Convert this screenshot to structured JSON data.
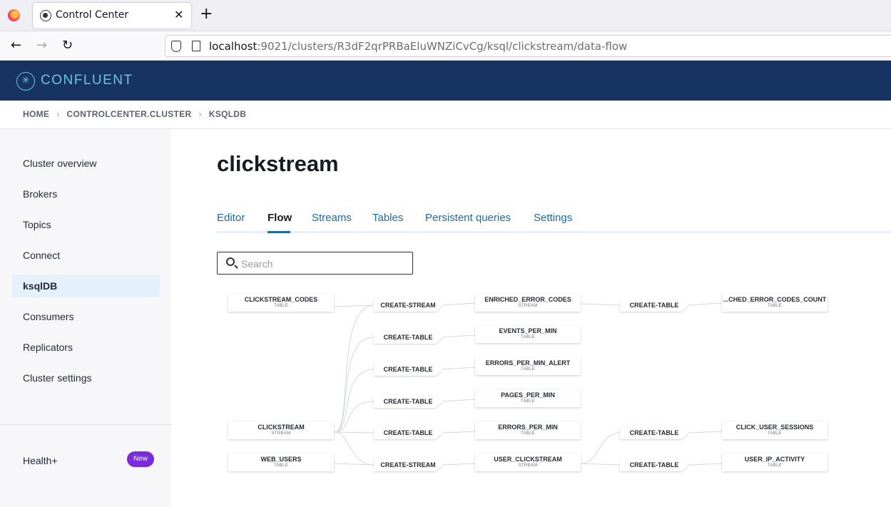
{
  "browser": {
    "tab_title": "Control Center",
    "tab_close": "✕",
    "new_tab": "+",
    "url_host": "localhost",
    "url_rest": ":9021/clusters/R3dF2qrPRBaEluWNZiCvCg/ksql/clickstream/data-flow",
    "back": "←",
    "forward": "→",
    "reload": "↻"
  },
  "header": {
    "brand": "CONFLUENT",
    "brand_icon": "✳"
  },
  "breadcrumb": [
    "HOME",
    "CONTROLCENTER.CLUSTER",
    "KSQLDB"
  ],
  "breadcrumb_sep": "›",
  "sidebar": {
    "items": [
      "Cluster overview",
      "Brokers",
      "Topics",
      "Connect",
      "ksqlDB",
      "Consumers",
      "Replicators",
      "Cluster settings"
    ],
    "active": "ksqlDB",
    "health": "Health+",
    "health_badge": "New"
  },
  "page": {
    "title": "clickstream",
    "tabs": [
      "Editor",
      "Flow",
      "Streams",
      "Tables",
      "Persistent queries",
      "Settings"
    ],
    "active_tab": "Flow",
    "search_placeholder": "Search"
  },
  "flow": {
    "sources": [
      {
        "name": "CLICKSTREAM_CODES",
        "type": "TABLE"
      },
      {
        "name": "CLICKSTREAM",
        "type": "STREAM"
      },
      {
        "name": "WEB_USERS",
        "type": "TABLE"
      }
    ],
    "ops1": [
      "CREATE-STREAM",
      "CREATE-TABLE",
      "CREATE-TABLE",
      "CREATE-TABLE",
      "CREATE-TABLE",
      "CREATE-STREAM"
    ],
    "mid": [
      {
        "name": "ENRICHED_ERROR_CODES",
        "type": "STREAM"
      },
      {
        "name": "EVENTS_PER_MIN",
        "type": "TABLE"
      },
      {
        "name": "ERRORS_PER_MIN_ALERT",
        "type": "TABLE"
      },
      {
        "name": "PAGES_PER_MIN",
        "type": "TABLE"
      },
      {
        "name": "ERRORS_PER_MIN",
        "type": "TABLE"
      },
      {
        "name": "USER_CLICKSTREAM",
        "type": "STREAM"
      }
    ],
    "ops2": [
      "CREATE-TABLE",
      "CREATE-TABLE",
      "CREATE-TABLE"
    ],
    "sinks": [
      {
        "name": "...CHED_ERROR_CODES_COUNT",
        "type": "TABLE"
      },
      {
        "name": "CLICK_USER_SESSIONS",
        "type": "TABLE"
      },
      {
        "name": "USER_IP_ACTIVITY",
        "type": "TABLE"
      }
    ]
  }
}
